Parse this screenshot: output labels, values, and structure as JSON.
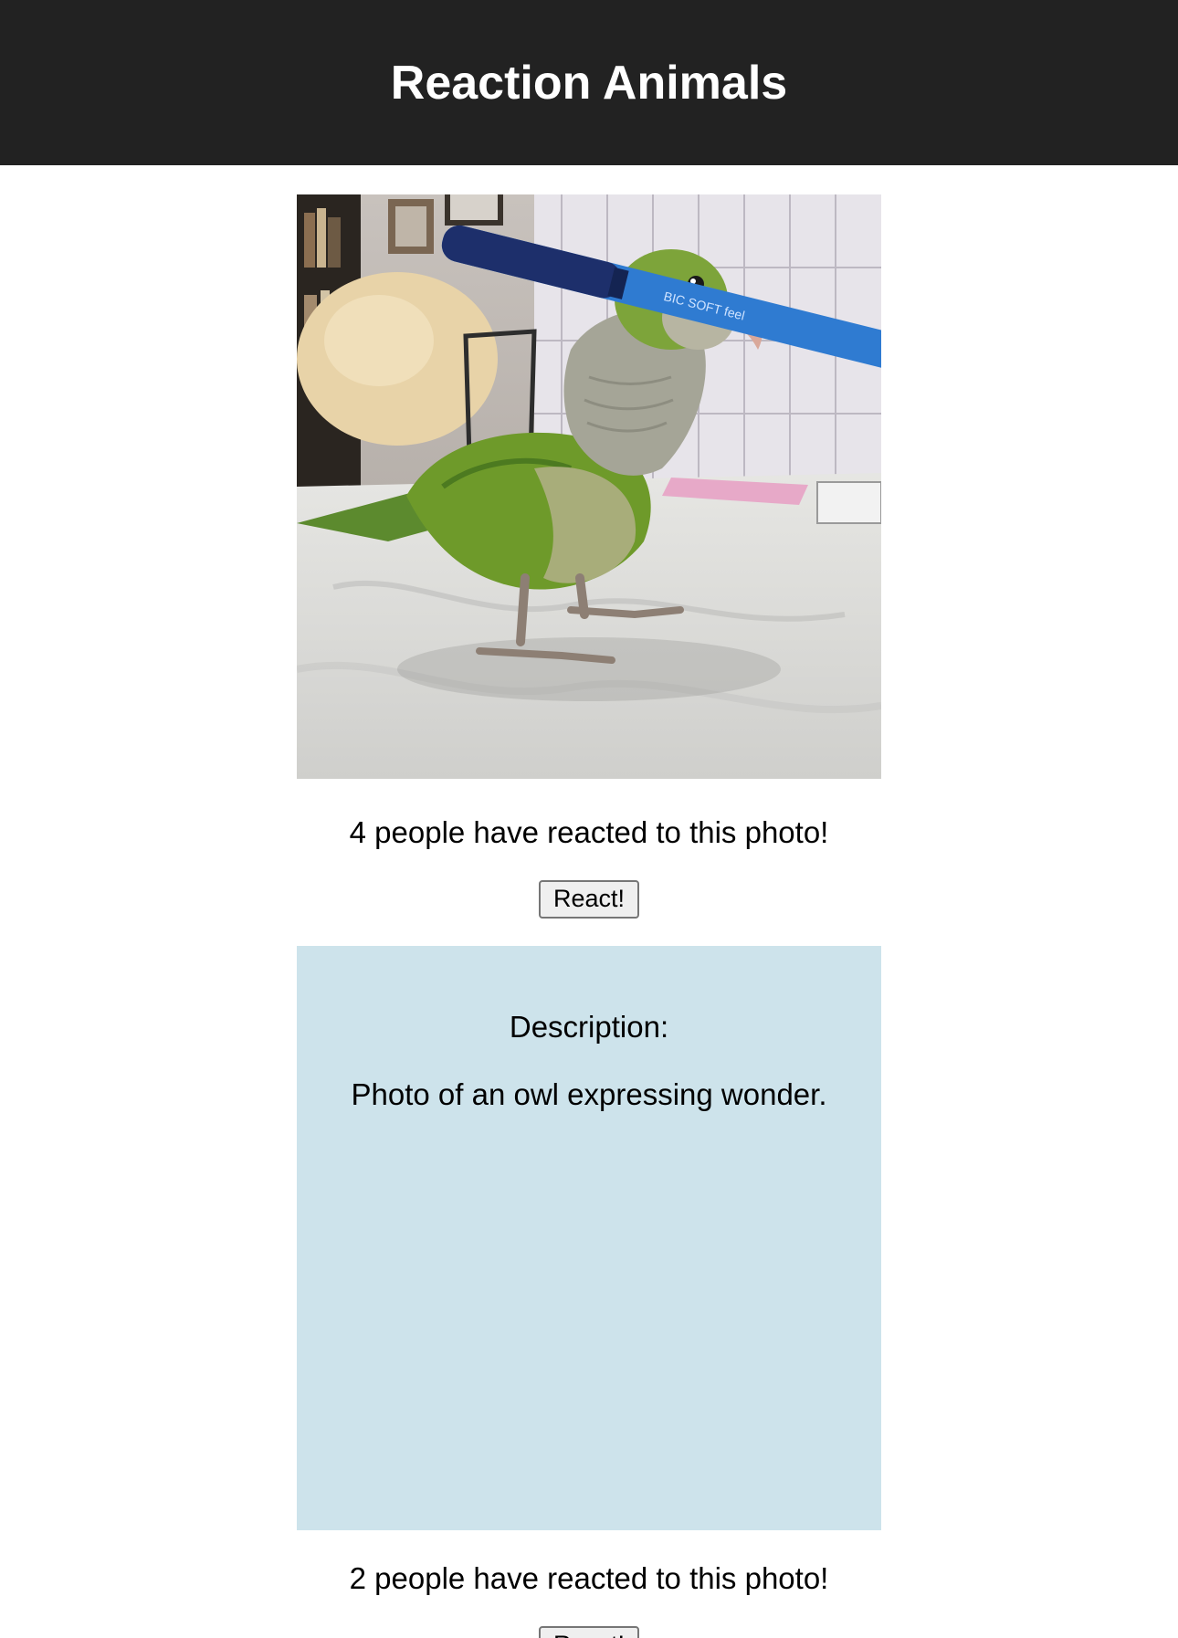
{
  "header": {
    "title": "Reaction Animals"
  },
  "posts": [
    {
      "image_alt": "parrot holding a blue pen",
      "reaction_text": "4 people have reacted to this photo!",
      "react_label": "React!"
    },
    {
      "description_label": "Description:",
      "description_text": "Photo of an owl expressing wonder.",
      "reaction_text": "2 people have reacted to this photo!",
      "react_label": "React!"
    }
  ],
  "colors": {
    "header_bg": "#222222",
    "description_bg": "#cde3eb"
  }
}
